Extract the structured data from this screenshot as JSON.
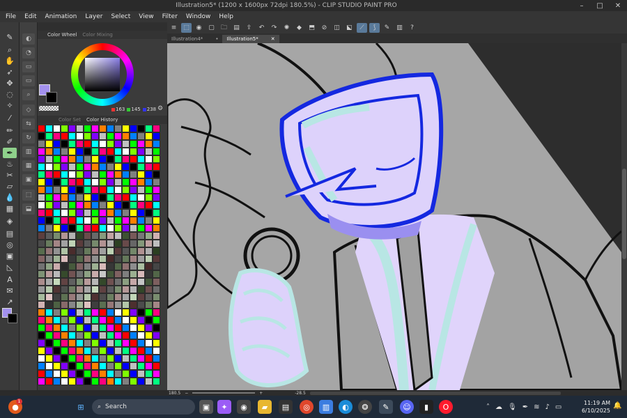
{
  "window": {
    "title": "Illustration5* (1200 x 1600px 72dpi 180.5%) - CLIP STUDIO PAINT PRO",
    "minimize": "–",
    "maximize": "□",
    "close": "✕"
  },
  "menu": [
    "File",
    "Edit",
    "Animation",
    "Layer",
    "Select",
    "View",
    "Filter",
    "Window",
    "Help"
  ],
  "color_panel": {
    "tab_wheel": "Color Wheel",
    "tab_mixing": "Color Mixing",
    "r": "163",
    "g": "145",
    "b": "238",
    "tab_set": "Color Set",
    "tab_history": "Color History",
    "main_color": "#a391ee"
  },
  "doc_tabs": [
    {
      "label": "Illustration4*",
      "active": false
    },
    {
      "label": "Illustration5*",
      "active": true
    }
  ],
  "status": {
    "zoom": "180.5",
    "angle": "-28.5"
  },
  "taskbar": {
    "search_label": "Search",
    "time": "11:19 AM",
    "date": "6/10/2025",
    "badge": "1"
  },
  "colors": {
    "accent_tool": "#8fd18b",
    "canvas_bg": "#a6a6a6",
    "head_fill": "#ddd2fb",
    "head_outline": "#1428e0",
    "shading": "#b8e6e4"
  }
}
